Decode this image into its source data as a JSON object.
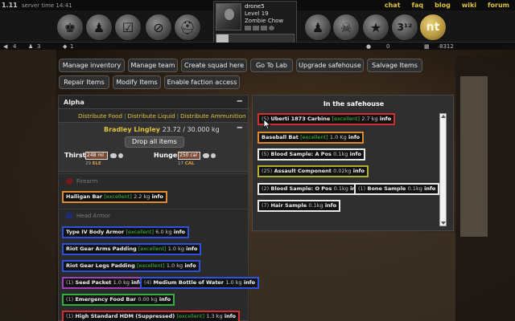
{
  "topbar": {
    "version": "1.11",
    "server_time": "server time 14:41",
    "links": [
      "chat",
      "faq",
      "blog",
      "wiki",
      "forum"
    ]
  },
  "header": {
    "left_icons": [
      "backpack-icon",
      "group-icon",
      "checklist-icon",
      "no-dog-icon",
      "cart-icon"
    ],
    "right_icons": [
      "zombie-icon",
      "skull-icon",
      "star-icon",
      "rank-icon",
      "nt-logo-icon"
    ],
    "rank_text": "3¹²",
    "logo_text": "nt"
  },
  "profile": {
    "name": "drone5",
    "level": "Level 19",
    "class": "Zombie Chow",
    "progress": 0.16
  },
  "stats": {
    "left_a": "4",
    "left_b": "3",
    "left_c": "1",
    "right_a": "0",
    "right_b": "8312"
  },
  "actions": {
    "row1": [
      "Manage inventory",
      "Manage team",
      "Create squad here",
      "Go To Lab",
      "Upgrade safehouse",
      "Salvage Items"
    ],
    "row2": [
      "Repair Items",
      "Modify Items",
      "Enable faction access"
    ]
  },
  "squad": {
    "name": "Alpha",
    "collapse": "−",
    "distribute": [
      "Distribute Food",
      "Distribute Liquid",
      "Distribute Ammunition"
    ],
    "member": {
      "name": "Bradley Lingley",
      "weight": "23.72 / 30.000 kg",
      "drop_label": "Drop all items",
      "thirst_label": "Thirst",
      "thirst_value": "248 ml",
      "thirst_sub_num": "29",
      "thirst_sub_unit": "ELE",
      "hunger_label": "Hunger",
      "hunger_value": "250 cal",
      "hunger_sub_num": "17",
      "hunger_sub_unit": "CAL"
    },
    "slots": {
      "firearm": "Firearm",
      "head_armor": "Head Armor"
    },
    "items": [
      {
        "qty": "",
        "name": "Halligan Bar",
        "cond": "[excellent]",
        "wt": "2.2 kg",
        "info": "info",
        "color": "#e08a30"
      },
      {
        "qty": "",
        "name": "Type IV Body Armor",
        "cond": "[excellent]",
        "wt": "6.0 kg",
        "info": "info",
        "color": "#3050e0"
      },
      {
        "qty": "",
        "name": "Riot Gear Arms Padding",
        "cond": "[excellent]",
        "wt": "1.0 kg",
        "info": "info",
        "color": "#3050e0"
      },
      {
        "qty": "",
        "name": "Riot Gear Legs Padding",
        "cond": "[excellent]",
        "wt": "1.0 kg",
        "info": "info",
        "color": "#3050e0"
      },
      {
        "qty": "(1)",
        "name": "Seed Packet",
        "cond": "",
        "wt": "1.0 kg",
        "info": "info",
        "color": "#a040c0"
      },
      {
        "qty": "(4)",
        "name": "Medium Bottle of Water",
        "cond": "",
        "wt": "1.0 kg",
        "info": "info",
        "color": "#3050e0"
      },
      {
        "qty": "(1)",
        "name": "Emergency Food Bar",
        "cond": "",
        "wt": "0.00 kg",
        "info": "info",
        "color": "#30b040"
      },
      {
        "qty": "(1)",
        "name": "High Standard HDM (Suppressed)",
        "cond": "[excellent]",
        "wt": "1.3 kg",
        "info": "info",
        "color": "#d03030"
      }
    ]
  },
  "safehouse": {
    "title": "In the safehouse",
    "items": [
      {
        "qty": "(5)",
        "name": "Uberti 1873 Carbine",
        "cond": "[excellent]",
        "wt": "2.7 kg",
        "info": "info",
        "color": "#d03030"
      },
      {
        "qty": "",
        "name": "Baseball Bat",
        "cond": "[excellent]",
        "wt": "1.0 Kg",
        "info": "info",
        "color": "#e08a30"
      },
      {
        "qty": "(5)",
        "name": "Blood Sample: A Pos",
        "cond": "",
        "wt": "0.1kg",
        "info": "info",
        "color": "#e8e8e8"
      },
      {
        "qty": "(25)",
        "name": "Assault Component",
        "cond": "",
        "wt": "0.02kg",
        "info": "info",
        "color": "#b0b030"
      },
      {
        "qty": "(2)",
        "name": "Blood Sample: O Pos",
        "cond": "",
        "wt": "0.1kg",
        "info": "info",
        "color": "#e8e8e8"
      },
      {
        "qty": "(1)",
        "name": "Bone Sample",
        "cond": "",
        "wt": "0.1kg",
        "info": "info",
        "color": "#e8e8e8"
      },
      {
        "qty": "(7)",
        "name": "Hair Sample",
        "cond": "",
        "wt": "0.1kg",
        "info": "info",
        "color": "#e8e8e8"
      }
    ]
  }
}
